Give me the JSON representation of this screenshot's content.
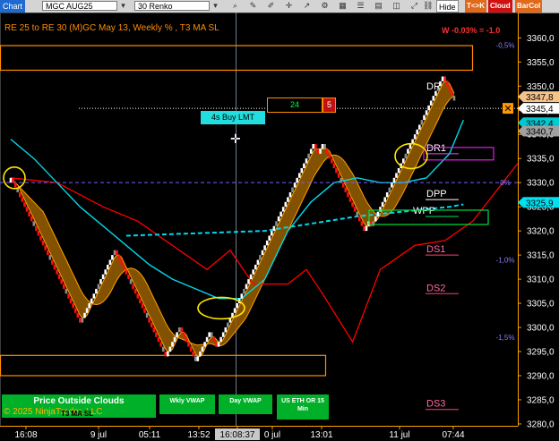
{
  "toolbar": {
    "chart_label": "Chart",
    "instrument": "MGC AUG25",
    "bar_type": "30 Renko",
    "hide_label": "Hide",
    "tk_label": "T<>K",
    "cloud_label": "Cloud",
    "barcol_label": "BarCol",
    "icons": [
      "dropdown-icon",
      "dropdown-icon",
      "magnifier-icon",
      "draw-icon",
      "pencil-icon",
      "crosshair-icon",
      "indicator-icon",
      "strategy-icon",
      "chart-style-icon",
      "properties-icon",
      "template-icon",
      "options-icon",
      "resize-icon",
      "link-icon"
    ]
  },
  "chart": {
    "title": "RE 25 to RE 30 (M)GC May 13, Weekly % , T3 MA SL",
    "week_change": "W -0.03% = -1.0",
    "crosshair_price": "3345,4",
    "colors": {
      "background": "#000000",
      "up_brick": "#ffffff",
      "down_brick": "#ff1010",
      "gray_brick": "#8c8c8c",
      "cloud": "#9a6000",
      "cloud_edge": "#ffa000",
      "cyan_ma": "#00d8e8",
      "trail": "#ff0000",
      "zone": "#ff8c00"
    }
  },
  "order": {
    "quantity": "24",
    "count": "5",
    "label": "4s  Buy LMT"
  },
  "pivots": [
    {
      "name": "DR1",
      "price": 3336
    },
    {
      "name": "DPP",
      "price": 3326.5
    },
    {
      "name": "WPP",
      "price": 3323
    },
    {
      "name": "DS1",
      "price": 3315
    },
    {
      "name": "DS2",
      "price": 3307
    },
    {
      "name": "DS3",
      "price": 3283
    }
  ],
  "pivot_top_label": "DR",
  "percent_labels": [
    {
      "text": "-0,5%",
      "price": 3358.5
    },
    {
      "text": "0%",
      "price": 3330
    },
    {
      "text": "-1,0%",
      "price": 3314
    },
    {
      "text": "-1,5%",
      "price": 3298
    }
  ],
  "buttons": {
    "price_outside": "Price Outside Clouds",
    "t3_ma_sl": "T3 MA SL",
    "wkly_vwap": "Wkly VWAP",
    "day_vwap": "Day VWAP",
    "us_eth_or": "US ETH OR 15 Min"
  },
  "copyright": "© 2025 NinjaTrader, LLC",
  "chart_data": {
    "type": "renko",
    "instrument": "MGC AUG25",
    "bar_size": "30 Renko",
    "y_ticks": [
      3360,
      3355,
      3350,
      3345,
      3340,
      3335,
      3330,
      3325,
      3320,
      3315,
      3310,
      3305,
      3300,
      3295,
      3290,
      3285,
      3280
    ],
    "ylim": [
      3278.5,
      3364.7
    ],
    "x_ticks": [
      "16:08",
      "9 jul",
      "05:11",
      "13:52",
      "16:08:37",
      "0 jul",
      "13:01",
      "11 jul",
      "07:44"
    ],
    "price_markers": [
      {
        "text": "3347,8",
        "price": 3347.8,
        "color": "#f4c38a"
      },
      {
        "text": "3345,4",
        "price": 3345.4,
        "color": "#ffffff"
      },
      {
        "text": "3342,4",
        "price": 3342.4,
        "color": "#00c8d0"
      },
      {
        "text": "3340,7",
        "price": 3340.7,
        "color": "#a0a0a0"
      },
      {
        "text": "3325,9",
        "price": 3325.9,
        "color": "#00e0f0"
      }
    ],
    "bricks_brick_size": 1.0,
    "brick_closes": [
      3331,
      3330,
      3329,
      3328,
      3327,
      3326,
      3325,
      3324,
      3323,
      3322,
      3321,
      3320,
      3319,
      3318,
      3317,
      3316,
      3315,
      3314,
      3313,
      3312,
      3311,
      3310,
      3309,
      3308,
      3307,
      3306,
      3305,
      3304,
      3303,
      3302,
      3301,
      3302,
      3303,
      3304,
      3305,
      3306,
      3307,
      3308,
      3309,
      3310,
      3311,
      3312,
      3313,
      3314,
      3315,
      3316,
      3315,
      3314,
      3313,
      3312,
      3311,
      3310,
      3309,
      3308,
      3307,
      3306,
      3305,
      3304,
      3303,
      3302,
      3301,
      3300,
      3299,
      3298,
      3297,
      3296,
      3295,
      3294,
      3295,
      3296,
      3297,
      3298,
      3299,
      3300,
      3299,
      3298,
      3297,
      3296,
      3295,
      3294,
      3293,
      3294,
      3295,
      3296,
      3297,
      3298,
      3299,
      3298,
      3297,
      3296,
      3297,
      3298,
      3299,
      3300,
      3301,
      3302,
      3303,
      3304,
      3305,
      3306,
      3307,
      3308,
      3309,
      3310,
      3311,
      3312,
      3313,
      3314,
      3315,
      3316,
      3317,
      3318,
      3319,
      3320,
      3321,
      3322,
      3323,
      3324,
      3325,
      3326,
      3327,
      3328,
      3329,
      3330,
      3331,
      3332,
      3333,
      3334,
      3335,
      3336,
      3337,
      3338,
      3337,
      3336,
      3337,
      3338,
      3337,
      3336,
      3335,
      3334,
      3333,
      3332,
      3331,
      3330,
      3329,
      3328,
      3327,
      3326,
      3325,
      3324,
      3323,
      3322,
      3321,
      3320,
      3321,
      3322,
      3321,
      3322,
      3323,
      3324,
      3325,
      3326,
      3327,
      3328,
      3329,
      3330,
      3331,
      3332,
      3333,
      3334,
      3335,
      3336,
      3337,
      3338,
      3339,
      3340,
      3341,
      3342,
      3343,
      3344,
      3345,
      3346,
      3347,
      3348,
      3349,
      3350,
      3351,
      3352,
      3351,
      3350,
      3349,
      3348,
      3347
    ],
    "cyan_ma": [
      [
        0,
        3339
      ],
      [
        10,
        3335
      ],
      [
        20,
        3330
      ],
      [
        30,
        3325
      ],
      [
        40,
        3321
      ],
      [
        50,
        3317
      ],
      [
        60,
        3313
      ],
      [
        70,
        3310
      ],
      [
        80,
        3308
      ],
      [
        90,
        3306
      ],
      [
        100,
        3306
      ],
      [
        110,
        3310
      ],
      [
        120,
        3320
      ],
      [
        130,
        3326
      ],
      [
        140,
        3330
      ],
      [
        150,
        3331
      ],
      [
        160,
        3330
      ],
      [
        170,
        3330
      ],
      [
        180,
        3331
      ],
      [
        190,
        3336
      ],
      [
        196,
        3343
      ]
    ],
    "dashed_ma": [
      [
        50,
        3319
      ],
      [
        110,
        3320
      ],
      [
        150,
        3323
      ],
      [
        190,
        3325
      ],
      [
        196,
        3325.5
      ]
    ],
    "trail_stop": [
      [
        0,
        3331
      ],
      [
        20,
        3330
      ],
      [
        40,
        3325
      ],
      [
        55,
        3322
      ],
      [
        85,
        3312
      ],
      [
        95,
        3316
      ],
      [
        105,
        3309
      ],
      [
        120,
        3309
      ],
      [
        128,
        3312
      ],
      [
        135,
        3307
      ],
      [
        148,
        3297
      ],
      [
        160,
        3312
      ],
      [
        175,
        3317
      ],
      [
        188,
        3318
      ],
      [
        200,
        3322
      ]
    ]
  }
}
